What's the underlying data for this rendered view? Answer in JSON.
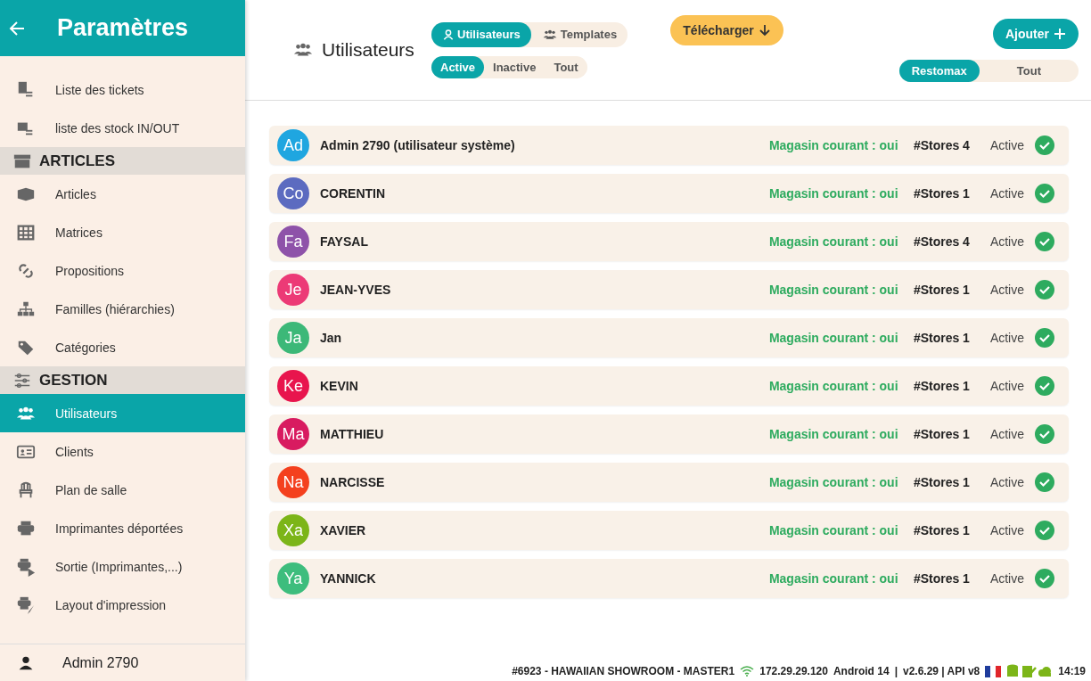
{
  "header": {
    "title": "Paramètres"
  },
  "sidebar": {
    "items": [
      {
        "kind": "item",
        "label": "Liste des tickets",
        "selected": false
      },
      {
        "kind": "item",
        "label": "liste des stock IN/OUT",
        "selected": false
      },
      {
        "kind": "section",
        "label": "ARTICLES"
      },
      {
        "kind": "item",
        "label": "Articles",
        "selected": false
      },
      {
        "kind": "item",
        "label": "Matrices",
        "selected": false
      },
      {
        "kind": "item",
        "label": "Propositions",
        "selected": false
      },
      {
        "kind": "item",
        "label": "Familles (hiérarchies)",
        "selected": false
      },
      {
        "kind": "item",
        "label": "Catégories",
        "selected": false
      },
      {
        "kind": "section",
        "label": "GESTION"
      },
      {
        "kind": "item",
        "label": "Utilisateurs",
        "selected": true
      },
      {
        "kind": "item",
        "label": "Clients",
        "selected": false
      },
      {
        "kind": "item",
        "label": "Plan de salle",
        "selected": false
      },
      {
        "kind": "item",
        "label": "Imprimantes déportées",
        "selected": false
      },
      {
        "kind": "item",
        "label": "Sortie (Imprimantes,...)",
        "selected": false
      },
      {
        "kind": "item",
        "label": "Layout d'impression",
        "selected": false
      }
    ]
  },
  "user": {
    "name": "Admin 2790"
  },
  "page": {
    "title": "Utilisateurs",
    "view_tabs": [
      {
        "label": "Utilisateurs",
        "selected": true
      },
      {
        "label": "Templates",
        "selected": false
      }
    ],
    "status_filters": [
      {
        "label": "Active",
        "selected": true
      },
      {
        "label": "Inactive",
        "selected": false
      },
      {
        "label": "Tout",
        "selected": false
      }
    ],
    "download_button": "Télécharger",
    "add_button": "Ajouter",
    "store_filters": [
      {
        "label": "Restomax",
        "selected": true
      },
      {
        "label": "Tout",
        "selected": false
      }
    ]
  },
  "users": [
    {
      "initials": "Ad",
      "name": "Admin 2790 (utilisateur système)",
      "color": "#1fa6e0",
      "current_store": "Magasin courant : oui",
      "stores": "#Stores 4",
      "status": "Active"
    },
    {
      "initials": "Co",
      "name": "CORENTIN",
      "color": "#5c6bc0",
      "current_store": "Magasin courant : oui",
      "stores": "#Stores 1",
      "status": "Active"
    },
    {
      "initials": "Fa",
      "name": "FAYSAL",
      "color": "#8e52a9",
      "current_store": "Magasin courant : oui",
      "stores": "#Stores 4",
      "status": "Active"
    },
    {
      "initials": "Je",
      "name": "JEAN-YVES",
      "color": "#ec3a76",
      "current_store": "Magasin courant : oui",
      "stores": "#Stores 1",
      "status": "Active"
    },
    {
      "initials": "Ja",
      "name": "Jan",
      "color": "#3cb878",
      "current_store": "Magasin courant : oui",
      "stores": "#Stores 1",
      "status": "Active"
    },
    {
      "initials": "Ke",
      "name": "KEVIN",
      "color": "#e8154d",
      "current_store": "Magasin courant : oui",
      "stores": "#Stores 1",
      "status": "Active"
    },
    {
      "initials": "Ma",
      "name": "MATTHIEU",
      "color": "#d81b60",
      "current_store": "Magasin courant : oui",
      "stores": "#Stores 1",
      "status": "Active"
    },
    {
      "initials": "Na",
      "name": "NARCISSE",
      "color": "#f4401e",
      "current_store": "Magasin courant : oui",
      "stores": "#Stores 1",
      "status": "Active"
    },
    {
      "initials": "Xa",
      "name": "XAVIER",
      "color": "#7cb518",
      "current_store": "Magasin courant : oui",
      "stores": "#Stores 1",
      "status": "Active"
    },
    {
      "initials": "Ya",
      "name": "YANNICK",
      "color": "#3dbd7d",
      "current_store": "Magasin courant : oui",
      "stores": "#Stores 1",
      "status": "Active"
    }
  ],
  "status_bar": {
    "device": "#6923 - HAWAIIAN SHOWROOM - MASTER1",
    "ip": "172.29.29.120",
    "android": "Android 14",
    "separator": "|",
    "version": "v2.6.29 | API v8",
    "time": "14:19"
  }
}
